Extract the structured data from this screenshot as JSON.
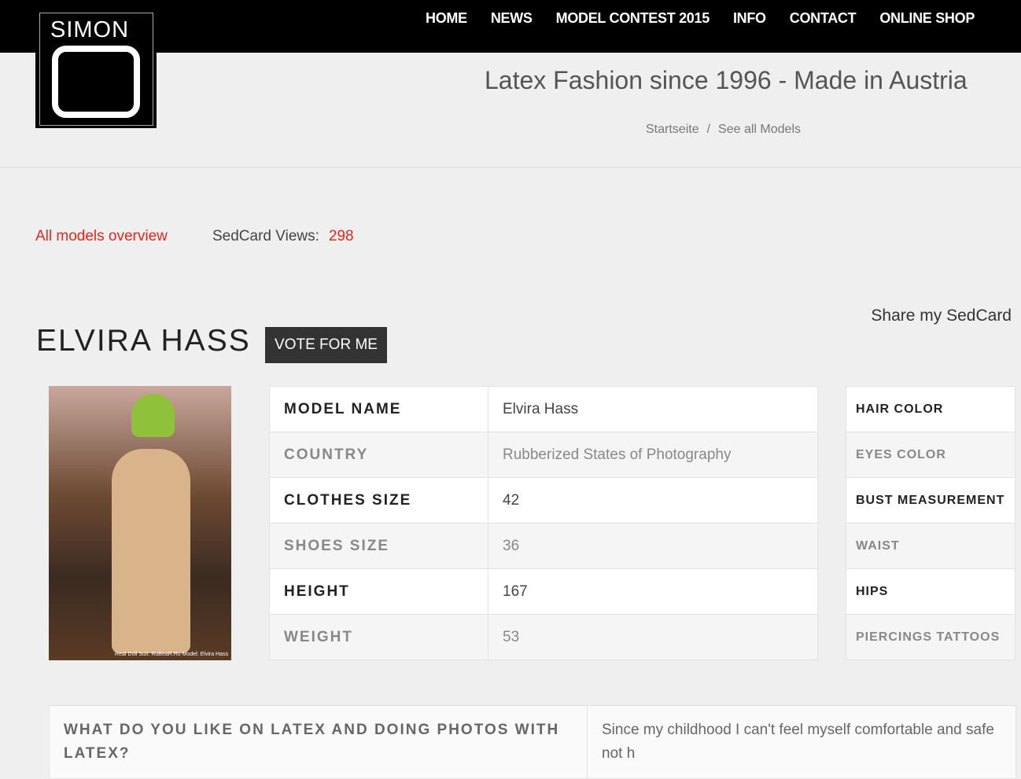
{
  "logo": {
    "text": "SIMON O"
  },
  "nav": [
    "HOME",
    "NEWS",
    "MODEL CONTEST 2015",
    "INFO",
    "CONTACT",
    "ONLINE SHOP"
  ],
  "tagline": "Latex Fashion since 1996 - Made in Austria",
  "breadcrumb": {
    "home": "Startseite",
    "sep": "/",
    "current": "See all Models"
  },
  "all_models": "All models overview",
  "views": {
    "label": "SedCard Views:",
    "count": "298"
  },
  "share": "Share my SedCard",
  "model_name": "ELVIRA HASS",
  "vote_label": "VOTE FOR ME",
  "photo_caption": "Real Doll Suit: RuBeaR.Ru Model: Elvira Hass",
  "details_left": [
    {
      "k": "MODEL NAME",
      "v": "Elvira Hass"
    },
    {
      "k": "COUNTRY",
      "v": "Rubberized States of Photography"
    },
    {
      "k": "CLOTHES SIZE",
      "v": "42"
    },
    {
      "k": "SHOES SIZE",
      "v": "36"
    },
    {
      "k": "HEIGHT",
      "v": "167"
    },
    {
      "k": "WEIGHT",
      "v": "53"
    }
  ],
  "details_right": [
    {
      "k": "HAIR COLOR"
    },
    {
      "k": "EYES COLOR"
    },
    {
      "k": "BUST MEASUREMENT"
    },
    {
      "k": "WAIST"
    },
    {
      "k": "HIPS"
    },
    {
      "k": "PIERCINGS TATTOOS"
    }
  ],
  "qa": {
    "question": "WHAT DO YOU LIKE ON LATEX AND DOING PHOTOS WITH LATEX?",
    "answer": "Since my childhood I can't feel myself comfortable and safe not h"
  }
}
